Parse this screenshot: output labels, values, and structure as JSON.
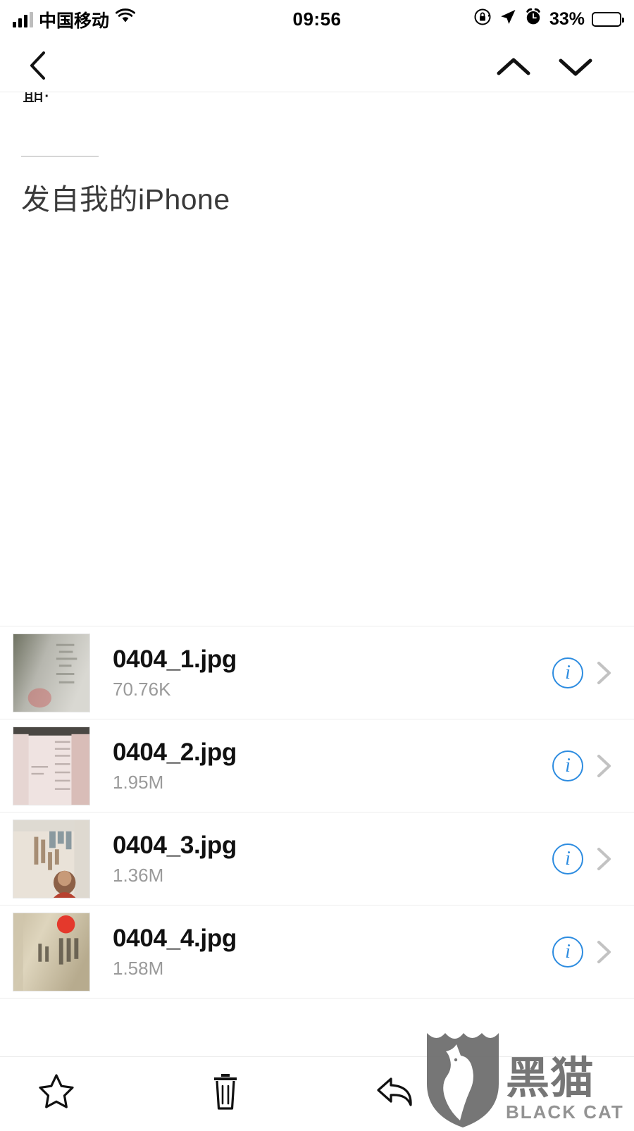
{
  "status_bar": {
    "carrier": "中国移动",
    "time": "09:56",
    "battery_percent": "33%",
    "battery_level": 33,
    "icons": {
      "signal": "signal-bars-icon",
      "wifi": "wifi-icon",
      "rotation_lock": "rotation-lock-icon",
      "location": "location-arrow-icon",
      "alarm": "alarm-clock-icon",
      "battery": "battery-icon"
    }
  },
  "nav_bar": {
    "back": "back-chevron",
    "previous_message": "chevron-up",
    "next_message": "chevron-down"
  },
  "message": {
    "clipped_text": "期:",
    "signature": "发自我的iPhone"
  },
  "attachments": [
    {
      "name": "0404_1.jpg",
      "size": "70.76K",
      "thumb": "scanned-document-gray",
      "info_label": "i"
    },
    {
      "name": "0404_2.jpg",
      "size": "1.95M",
      "thumb": "scanned-document-pink",
      "info_label": "i"
    },
    {
      "name": "0404_3.jpg",
      "size": "1.36M",
      "thumb": "id-card-photo",
      "info_label": "i"
    },
    {
      "name": "0404_4.jpg",
      "size": "1.58M",
      "thumb": "stamped-document-beige",
      "info_label": "i"
    }
  ],
  "toolbar": {
    "flag": "star-icon",
    "delete": "trash-icon",
    "reply": "reply-arrow-icon"
  },
  "watermark": {
    "chinese": "黑猫",
    "english": "BLACK CAT",
    "color": "#6f6f6f"
  },
  "colors": {
    "accent_blue": "#2d8ce0",
    "separator": "#ededed",
    "secondary_text": "#9a9a9a",
    "primary_text": "#111111"
  }
}
